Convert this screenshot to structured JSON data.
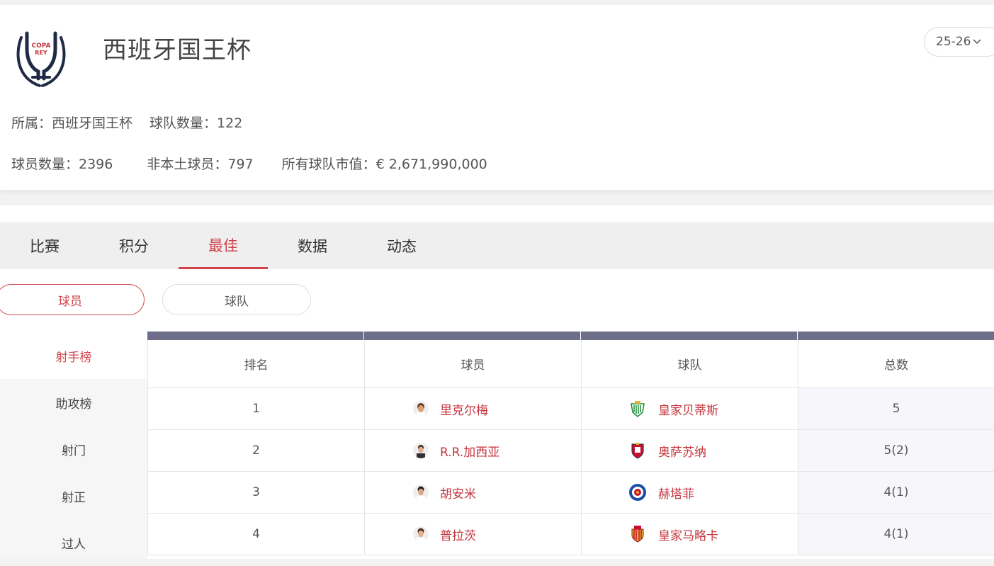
{
  "competition": {
    "title": "西班牙国王杯",
    "logo_text_1": "COPA",
    "logo_text_2": "REY",
    "season": "25-26",
    "info": {
      "belongs": "所属：西班牙国王杯",
      "team_count": "球队数量：122",
      "player_count": "球员数量：2396",
      "foreign_players": "非本土球员：797",
      "market_value": "所有球队市值：€ 2,671,990,000"
    }
  },
  "tabs": [
    "比赛",
    "积分",
    "最佳",
    "数据",
    "动态"
  ],
  "active_tab": "最佳",
  "toggle": {
    "player": "球员",
    "team": "球队"
  },
  "side_menu": [
    "射手榜",
    "助攻榜",
    "射门",
    "射正",
    "过人"
  ],
  "table": {
    "headers": [
      "排名",
      "球员",
      "球队",
      "总数"
    ],
    "rows": [
      {
        "rank": "1",
        "player": "里克尔梅",
        "team": "皇家贝蒂斯",
        "total": "5"
      },
      {
        "rank": "2",
        "player": "R.R.加西亚",
        "team": "奥萨苏纳",
        "total": "5(2)"
      },
      {
        "rank": "3",
        "player": "胡安米",
        "team": "赫塔菲",
        "total": "4(1)"
      },
      {
        "rank": "4",
        "player": "普拉茨",
        "team": "皇家马略卡",
        "total": "4(1)"
      }
    ]
  },
  "colors": {
    "accent": "#d0454c",
    "header_bar": "#6f6e8a"
  }
}
